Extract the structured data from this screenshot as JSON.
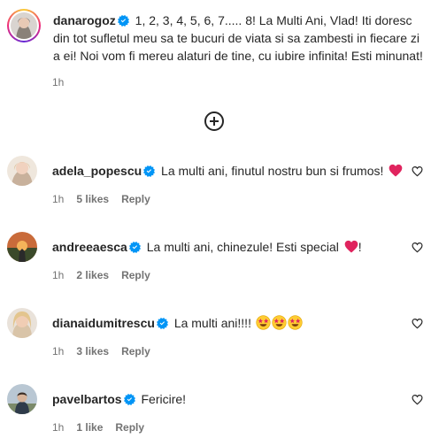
{
  "caption": {
    "username": "danarogoz",
    "text": "1, 2, 3, 4, 5, 6, 7..... 8! La Multi Ani, Vlad! Iti doresc din tot sufletul meu sa te bucuri de viata si sa zambesti in fiecare zi a ei! Noi vom fi mereu alaturi de tine, cu iubire infinita! Esti minunat!",
    "time": "1h"
  },
  "more_replies_icon": "plus-circle-icon",
  "comments": [
    {
      "username": "adela_popescu",
      "text": "La multi ani, finutul nostru bun si frumos!",
      "emoji_suffix": "",
      "time": "1h",
      "likes": "5 likes",
      "reply": "Reply"
    },
    {
      "username": "andreeaesca",
      "text": "La multi ani, chinezule! Esti special",
      "emoji_suffix": "!",
      "time": "1h",
      "likes": "2 likes",
      "reply": "Reply"
    },
    {
      "username": "dianaidumitrescu",
      "text": "La multi ani!!!!",
      "emoji_suffix": "",
      "time": "1h",
      "likes": "3 likes",
      "reply": "Reply"
    },
    {
      "username": "pavelbartos",
      "text": "Fericire!",
      "emoji_suffix": "",
      "time": "1h",
      "likes": "1 like",
      "reply": "Reply"
    }
  ],
  "colors": {
    "verified": "#0095f6",
    "heart_red": "#e0245e",
    "meta_gray": "#737373",
    "text": "#262626"
  }
}
